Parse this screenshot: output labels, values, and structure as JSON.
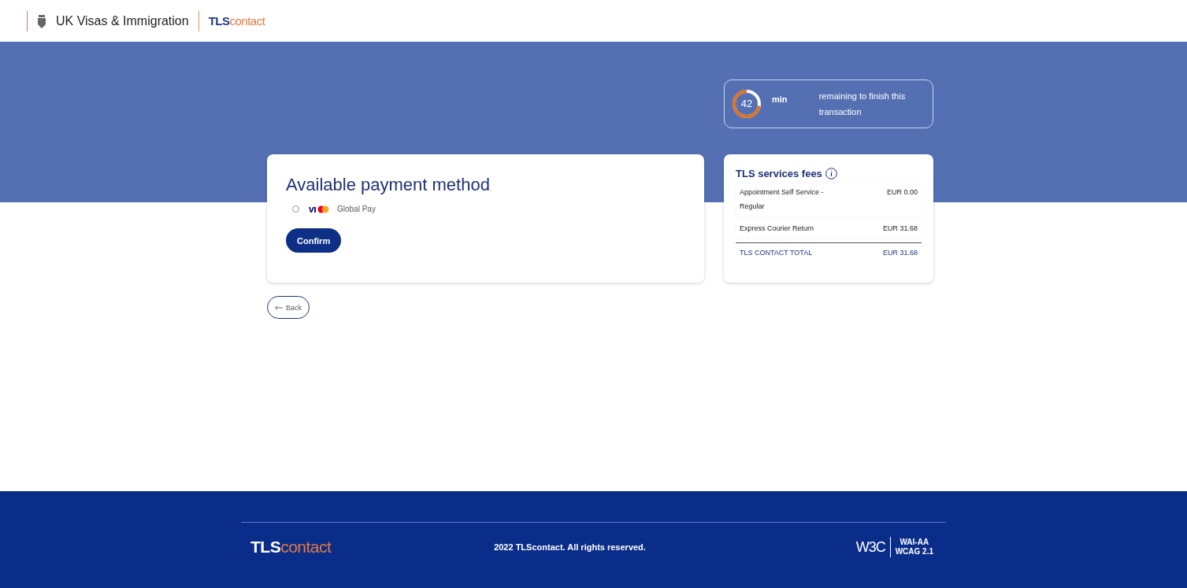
{
  "header": {
    "agency": "UK Visas & Immigration",
    "brand": {
      "part_1": "TLS",
      "part_2": "contact"
    }
  },
  "timer": {
    "minutes": "42",
    "unit": "min",
    "message": "remaining to finish this transaction"
  },
  "payment": {
    "title": "Available payment method",
    "methods": [
      {
        "label": "Global Pay",
        "selected": false
      }
    ],
    "confirm": "Confirm"
  },
  "back": "Back",
  "fees": {
    "title": "TLS services fees",
    "rows": [
      {
        "kind": "item",
        "label": "Appointment Self Service - Regular",
        "amount": "EUR 0.00"
      },
      {
        "kind": "item",
        "label": "Express Courier Return",
        "amount": "EUR 31.68"
      },
      {
        "kind": "total",
        "label": "TLS CONTACT TOTAL",
        "amount": "EUR 31.68"
      }
    ]
  },
  "footer": {
    "brand": {
      "part_1": "TLS",
      "part_2": "contact"
    },
    "copyright": "2022 TLScontact. All rights reserved.",
    "w3c": "W3C",
    "badge": [
      "WAI-AA",
      "WCAG 2.1"
    ]
  }
}
